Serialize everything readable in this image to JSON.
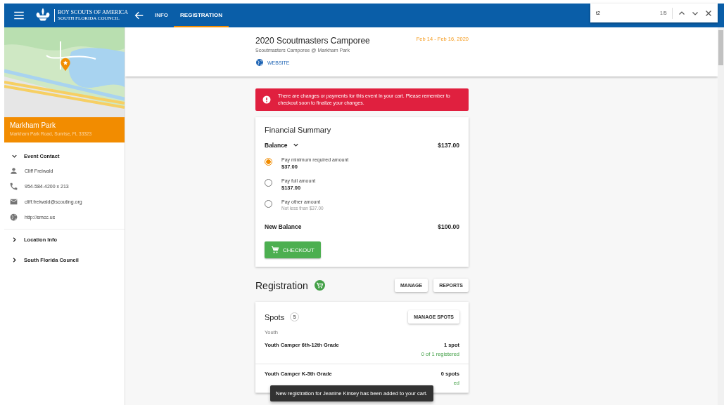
{
  "app_bar": {
    "brand_line_1": "BOY SCOUTS OF AMERICA",
    "brand_line_2": "SOUTH FLORIDA COUNCIL",
    "tabs": [
      {
        "label": "INFO",
        "selected": false
      },
      {
        "label": "REGISTRATION",
        "selected": true
      }
    ]
  },
  "find_bar": {
    "value": "t2",
    "count": "1/5"
  },
  "sidebar": {
    "location": {
      "name": "Markham Park",
      "address": "Markham Park Road, Sunrise, FL 33323"
    },
    "sections": [
      {
        "title": "Event Contact",
        "expanded": true,
        "items": [
          {
            "kind": "person",
            "text": "Cliff Freiwald"
          },
          {
            "kind": "phone",
            "text": "954-584-4200 x 213"
          },
          {
            "kind": "email",
            "text": "cliff.freiwald@scouting.org"
          },
          {
            "kind": "web",
            "text": "http://smcc.us"
          }
        ]
      },
      {
        "title": "Location Info",
        "expanded": false
      },
      {
        "title": "South Florida Council",
        "expanded": false
      }
    ]
  },
  "event": {
    "title": "2020 Scoutmasters Camporee",
    "subtitle": "Scoutmasters Camporee @ Markham Park",
    "dates": "Feb 14 - Feb 16, 2020",
    "link": "WEBSITE"
  },
  "alert": "There are changes or payments for this event in your cart. Please remember to checkout soon to finalize your changes.",
  "financial_summary": {
    "title": "Financial Summary",
    "balance_label": "Balance",
    "balance": "$137.00",
    "options": [
      {
        "label": "Pay minimum required amount",
        "amount": "$37.00",
        "selected": true
      },
      {
        "label": "Pay full amount",
        "amount": "$137.00",
        "selected": false
      },
      {
        "label": "Pay other amount",
        "note": "Not less than $37.00",
        "selected": false
      }
    ],
    "new_balance_label": "New Balance",
    "new_balance": "$100.00",
    "button": "CHECKOUT"
  },
  "registration": {
    "title": "Registration",
    "buttons": [
      "MANAGE",
      "REPORTS"
    ]
  },
  "spots": {
    "title": "Spots",
    "count": "5",
    "button": "MANAGE SPOTS",
    "group": "Youth",
    "rows": [
      {
        "name": "Youth Camper 6th-12th Grade",
        "spots": "1 spot",
        "registered": "0 of 1 registered"
      },
      {
        "name": "Youth Camper K-5th Grade",
        "spots": "0 spots",
        "registered": "ed"
      }
    ]
  },
  "toast": "New registration for Jeanine Kinsey has been added to your cart."
}
